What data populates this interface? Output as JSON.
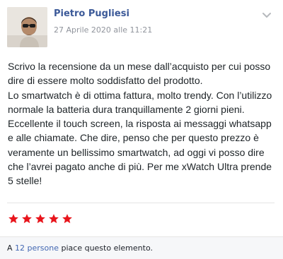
{
  "review": {
    "author_name": "Pietro Pugliesi",
    "date": "27 Aprile 2020 alle 11:21",
    "body": [
      "Scrivo la recensione da un mese dall’acquisto per cui posso dire di essere molto soddisfatto del prodotto.",
      "Lo smartwatch è di ottima fattura, molto trendy. Con l’utilizzo normale la batteria dura tranquillamente 2 giorni pieni. Eccellente il touch screen, la risposta ai messaggi whatsapp e alle chiamate. Che dire, penso che per questo prezzo è veramente un bellissimo smartwatch, ad oggi vi posso dire che l’avrei pagato anche di più. Per me xWatch Ultra prende 5 stelle!"
    ],
    "rating": 5,
    "rating_max": 5
  },
  "likes": {
    "prefix": "A ",
    "link_text": "12 persone",
    "suffix": " piace questo elemento."
  },
  "icons": {
    "menu": "chevron-down-icon",
    "star": "star-icon"
  },
  "colors": {
    "author": "#3b5998",
    "date": "#90949c",
    "star": "#e8141b",
    "link": "#4267b2"
  }
}
